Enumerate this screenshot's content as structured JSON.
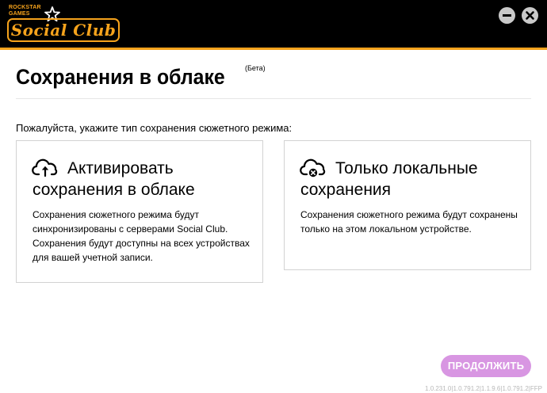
{
  "header": {
    "logo_top": "ROCKSTAR\nGAMES",
    "logo_text": "Social Club",
    "brand_color": "#f6a31c",
    "minimize_icon": "minimize-icon",
    "close_icon": "close-icon"
  },
  "page": {
    "title": "Сохранения в облаке",
    "beta": "(Бета)",
    "instruction": "Пожалуйста, укажите тип сохранения сюжетного режима:"
  },
  "options": {
    "cloud": {
      "icon": "cloud-upload-icon",
      "title": "Активировать сохранения в облаке",
      "description": "Сохранения сюжетного режима будут синхронизированы с серверами Social Club. Сохранения будут доступны на всех устройствах для вашей учетной записи."
    },
    "local": {
      "icon": "cloud-disabled-icon",
      "title": "Только локальные сохранения",
      "description": "Сохранения сюжетного режима будут сохранены только на этом локальном устройстве."
    }
  },
  "footer": {
    "continue_label": "ПРОДОЛЖИТЬ",
    "continue_color": "#d896e2",
    "version": "1.0.231.0|1.0.791.2|1.1.9.6|1.0.791.2|FFP"
  }
}
